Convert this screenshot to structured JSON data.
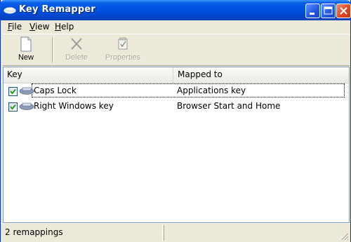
{
  "window": {
    "title": "Key Remapper",
    "app_icon": "keyboard-icon",
    "controls": [
      "minimize-icon",
      "maximize-icon",
      "close-icon"
    ]
  },
  "menu": {
    "items": [
      {
        "label": "File",
        "accel": "F",
        "rest": "ile"
      },
      {
        "label": "View",
        "accel": "V",
        "rest": "iew"
      },
      {
        "label": "Help",
        "accel": "H",
        "rest": "elp"
      }
    ]
  },
  "toolbar": {
    "new_label": "New",
    "delete_label": "Delete",
    "properties_label": "Properties",
    "icons": {
      "new": "document-icon",
      "delete": "x-icon",
      "properties": "properties-icon"
    },
    "disabled_color": "#aca899"
  },
  "list": {
    "columns": [
      "Key",
      "Mapped to"
    ],
    "rows": [
      {
        "checked": true,
        "key": "Caps Lock",
        "mapped_to": "Applications key"
      },
      {
        "checked": true,
        "key": "Right Windows key",
        "mapped_to": "Browser Start and Home"
      }
    ]
  },
  "status": {
    "text": "2 remappings"
  },
  "colors": {
    "titlebar": "#0054e3",
    "face": "#ece9d8",
    "close_button": "#d8461c"
  }
}
